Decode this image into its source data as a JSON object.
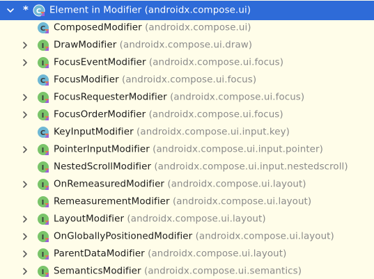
{
  "tree": {
    "root": {
      "name": "Element in Modifier",
      "package": "(androidx.compose.ui)",
      "icon": "kotlin-class-interface-icon",
      "marker": "*",
      "expanded": true,
      "selected": true
    },
    "items": [
      {
        "name": "ComposedModifier",
        "package": "(androidx.compose.ui)",
        "icon": "kotlin-class-icon",
        "expandable": false
      },
      {
        "name": "DrawModifier",
        "package": "(androidx.compose.ui.draw)",
        "icon": "kotlin-interface-icon",
        "expandable": true
      },
      {
        "name": "FocusEventModifier",
        "package": "(androidx.compose.ui.focus)",
        "icon": "kotlin-interface-icon",
        "expandable": true
      },
      {
        "name": "FocusModifier",
        "package": "(androidx.compose.ui.focus)",
        "icon": "kotlin-class-icon",
        "expandable": false
      },
      {
        "name": "FocusRequesterModifier",
        "package": "(androidx.compose.ui.focus)",
        "icon": "kotlin-interface-icon",
        "expandable": true
      },
      {
        "name": "FocusOrderModifier",
        "package": "(androidx.compose.ui.focus)",
        "icon": "kotlin-interface-icon",
        "expandable": true
      },
      {
        "name": "KeyInputModifier",
        "package": "(androidx.compose.ui.input.key)",
        "icon": "kotlin-class-icon",
        "expandable": false
      },
      {
        "name": "PointerInputModifier",
        "package": "(androidx.compose.ui.input.pointer)",
        "icon": "kotlin-interface-icon",
        "expandable": true
      },
      {
        "name": "NestedScrollModifier",
        "package": "(androidx.compose.ui.input.nestedscroll)",
        "icon": "kotlin-interface-icon",
        "expandable": false
      },
      {
        "name": "OnRemeasuredModifier",
        "package": "(androidx.compose.ui.layout)",
        "icon": "kotlin-interface-icon",
        "expandable": true
      },
      {
        "name": "RemeasurementModifier",
        "package": "(androidx.compose.ui.layout)",
        "icon": "kotlin-interface-icon",
        "expandable": false
      },
      {
        "name": "LayoutModifier",
        "package": "(androidx.compose.ui.layout)",
        "icon": "kotlin-interface-icon",
        "expandable": true
      },
      {
        "name": "OnGloballyPositionedModifier",
        "package": "(androidx.compose.ui.layout)",
        "icon": "kotlin-interface-icon",
        "expandable": true
      },
      {
        "name": "ParentDataModifier",
        "package": "(androidx.compose.ui.layout)",
        "icon": "kotlin-interface-icon",
        "expandable": true
      },
      {
        "name": "SemanticsModifier",
        "package": "(androidx.compose.ui.semantics)",
        "icon": "kotlin-interface-icon",
        "expandable": true
      }
    ]
  },
  "colors": {
    "background": "#fffde9",
    "selection": "#2e6bd8",
    "text": "#1b1b1b",
    "package_text": "#8a8a8a",
    "interface_icon": "#7ac46a",
    "class_icon": "#6fb8d4",
    "chevron": "#5a5a5a"
  }
}
